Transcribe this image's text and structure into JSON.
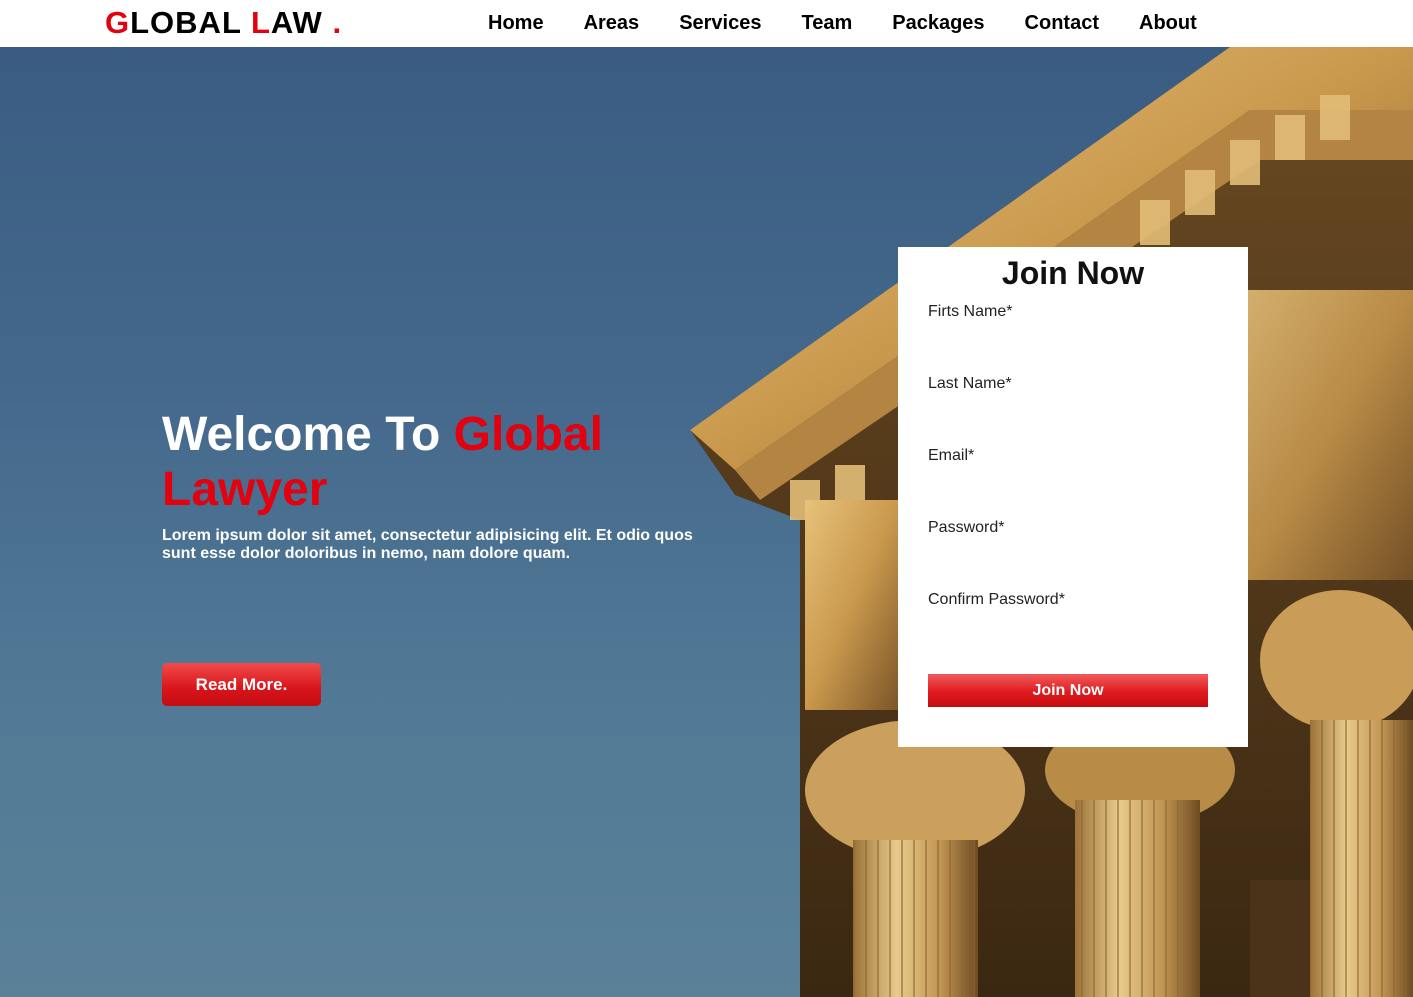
{
  "header": {
    "logo_first_letter": "G",
    "logo_rest1": "LOBAL ",
    "logo_second_letter": "L",
    "logo_rest2": "AW ",
    "logo_dot": ".",
    "nav": [
      {
        "label": "Home"
      },
      {
        "label": "Areas"
      },
      {
        "label": "Services"
      },
      {
        "label": "Team"
      },
      {
        "label": "Packages"
      },
      {
        "label": "Contact"
      },
      {
        "label": "About"
      }
    ]
  },
  "hero": {
    "title_part1": "Welcome To ",
    "title_part2": "Global Lawyer",
    "lead": "Lorem ipsum dolor sit amet, consectetur adipisicing elit. Et odio quos sunt esse dolor doloribus in nemo, nam dolore quam.",
    "read_more_label": "Read More."
  },
  "join_form": {
    "title": "Join Now",
    "fields": [
      {
        "label": "Firts Name*",
        "value": ""
      },
      {
        "label": "Last Name*",
        "value": ""
      },
      {
        "label": "Email*",
        "value": ""
      },
      {
        "label": "Password*",
        "value": ""
      },
      {
        "label": "Confirm Password*",
        "value": ""
      }
    ],
    "submit_label": "Join Now"
  },
  "colors": {
    "accent_red": "#e3000f",
    "sky_blue": "#44688c",
    "stone_gold": "#c79a4e"
  },
  "icons": {
    "background_image": "courthouse-columns-photo"
  }
}
